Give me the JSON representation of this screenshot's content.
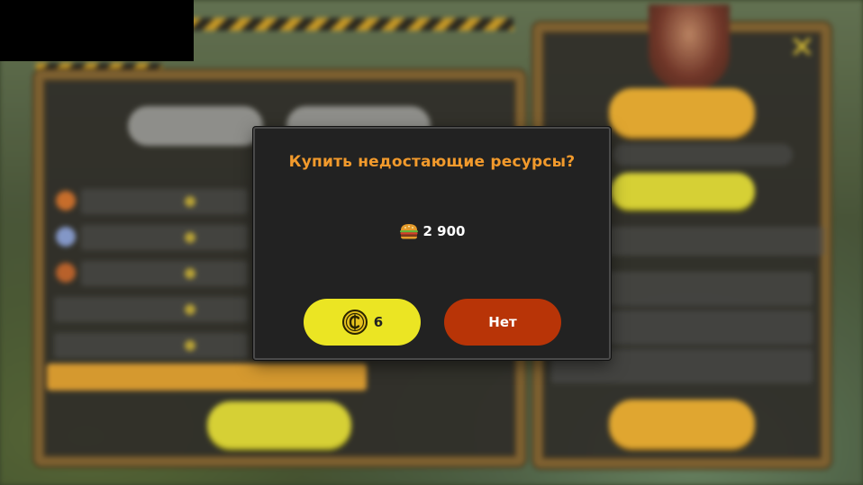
{
  "dialog": {
    "title": "Купить недостающие ресурсы?",
    "cost": {
      "icon": "burger-icon",
      "amount": "2 900"
    },
    "buy_button": {
      "icon": "coin-icon",
      "label": "6"
    },
    "no_button": {
      "label": "Нет"
    }
  },
  "colors": {
    "title": "#f29a2c",
    "buy_button": "#ebe523",
    "no_button": "#b83407",
    "dialog_bg": "#222222"
  }
}
